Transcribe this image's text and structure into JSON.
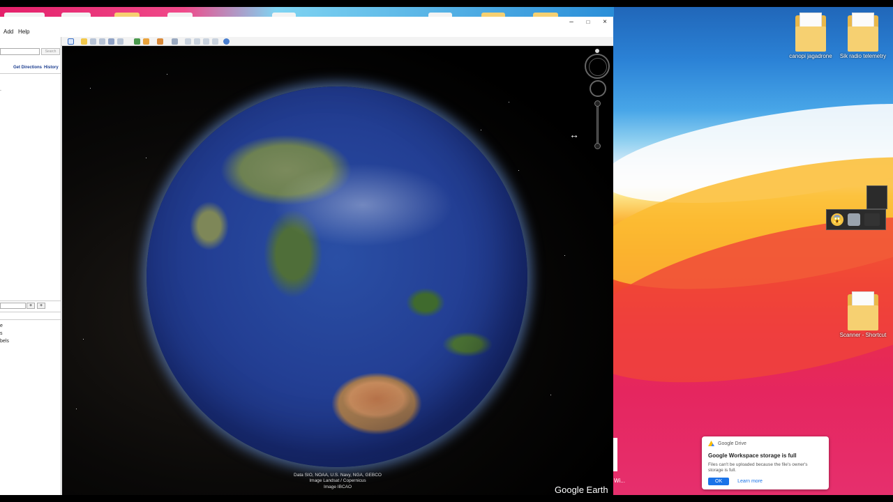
{
  "window": {
    "menu": {
      "add": "Add",
      "help": "Help"
    },
    "controls": {
      "minimize": "–",
      "maximize": "□",
      "close": "×"
    }
  },
  "sidebar": {
    "search_button": "Search",
    "get_directions": "Get Directions",
    "history": "History",
    "places_add": "+",
    "places_remove": "+",
    "layers_fragments": [
      "e",
      "s",
      "bels"
    ]
  },
  "viewer": {
    "attribution": [
      "Data SIO, NOAA, U.S. Navy, NGA, GEBCO",
      "Image Landsat / Copernicus",
      "Image IBCAO"
    ],
    "brand": "Google Earth"
  },
  "desktop": {
    "icons": [
      {
        "label": "canopi jagadrone"
      },
      {
        "label": "Sik radio telemetry"
      },
      {
        "label": "Scanner - Shortcut"
      }
    ],
    "peek_label": "Wi..."
  },
  "toast": {
    "source": "Google Drive",
    "title": "Google Workspace storage is full",
    "message": "Files can't be uploaded because the file's owner's storage is full.",
    "ok": "OK",
    "learn_more": "Learn more"
  }
}
